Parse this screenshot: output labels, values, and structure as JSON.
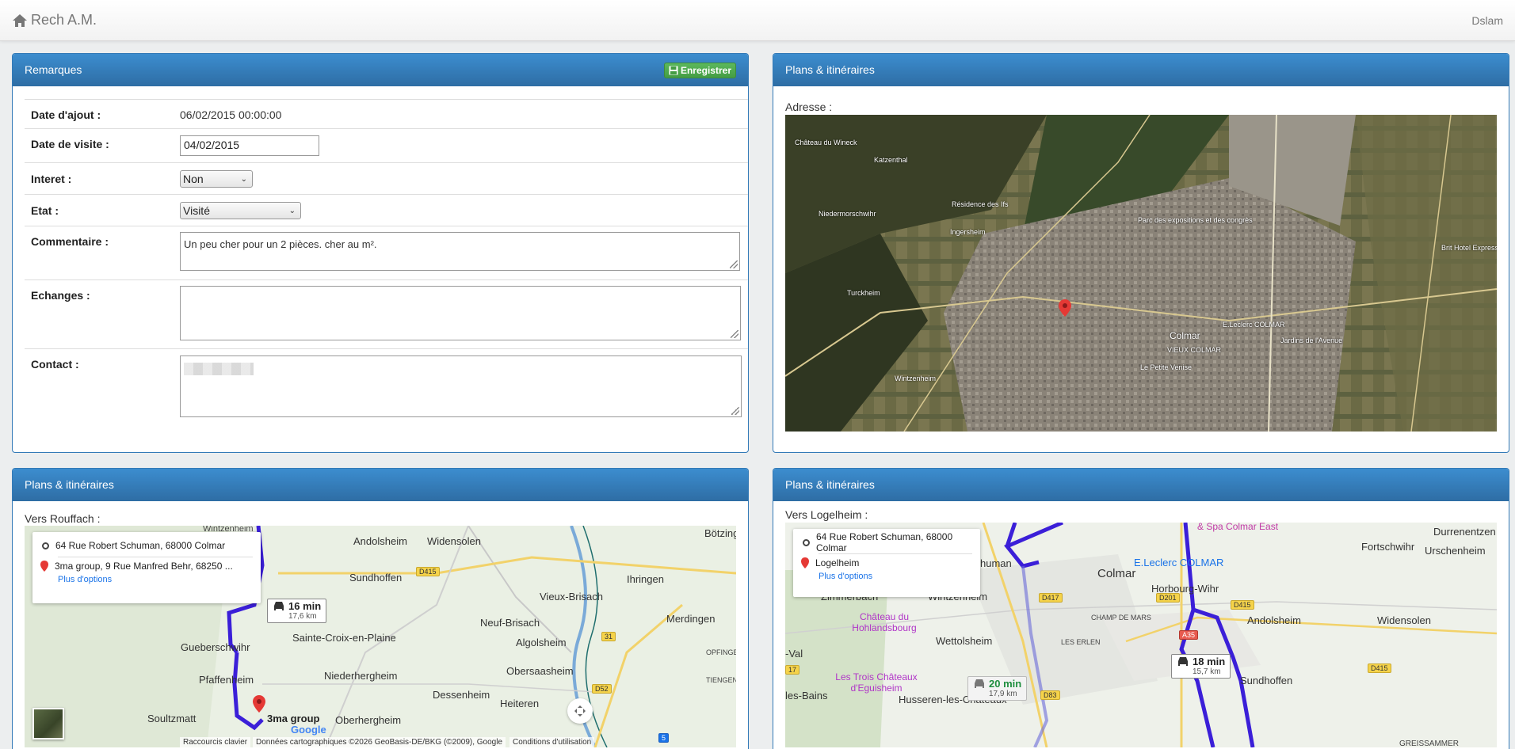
{
  "navbar": {
    "brand": "Rech A.M.",
    "user": "Dslam"
  },
  "remarques": {
    "title": "Remarques",
    "save_label": "Enregistrer",
    "fields": {
      "date_ajout": {
        "label": "Date d'ajout :",
        "value": "06/02/2015 00:00:00"
      },
      "date_visite": {
        "label": "Date de visite :",
        "value": "04/02/2015"
      },
      "interet": {
        "label": "Interet :",
        "value": "Non"
      },
      "etat": {
        "label": "Etat :",
        "value": "Visité"
      },
      "commentaire": {
        "label": "Commentaire :",
        "value": "Un peu cher pour un 2 pièces. cher au m²."
      },
      "echanges": {
        "label": "Echanges :",
        "value": ""
      },
      "contact": {
        "label": "Contact :",
        "value": ""
      }
    }
  },
  "map_address": {
    "title": "Plans & itinéraires",
    "caption": "Adresse :",
    "labels": [
      "Château du Wineck",
      "Katzenthal",
      "Niedermorschwihr",
      "Ingersheim",
      "Résidence des Ifs",
      "Parc des expositions et des congrès",
      "Turckheim",
      "Colmar",
      "VIEUX COLMAR",
      "Le Petite Venise",
      "Wintzenheim",
      "E.Leclerc COLMAR",
      "Jardins de l'Avenue",
      "Brit Hotel Express Colmar"
    ]
  },
  "map_rouffach": {
    "title": "Plans & itinéraires",
    "caption": "Vers Rouffach :",
    "origin": "64 Rue Robert Schuman, 68000 Colmar",
    "destination": "3ma group, 9 Rue Manfred Behr, 68250 ...",
    "more_options": "Plus d'options",
    "time": "16 min",
    "distance": "17,6 km",
    "dest_label": "3ma group",
    "labels": [
      "Wintzenheim",
      "Andolsheim",
      "Widensolen",
      "Bötzingen",
      "Sundhoffen",
      "Ihringen",
      "Vieux-Brisach",
      "Neuf-Brisach",
      "Merdingen",
      "Gueberschwihr",
      "Sainte-Croix-en-Plaine",
      "Algolsheim",
      "Pfaffenheim",
      "Niederhergheim",
      "Obersaasheim",
      "Dessenheim",
      "Heiteren",
      "Soultzmatt",
      "Oberhergheim",
      "OPFINGEN",
      "TIENGEN"
    ],
    "roads": [
      "D415",
      "31",
      "D52",
      "5"
    ],
    "attribution": [
      "Raccourcis clavier",
      "Données cartographiques ©2026 GeoBasis-DE/BKG (©2009), Google",
      "Conditions d'utilisation"
    ],
    "google": "Google"
  },
  "map_logelheim": {
    "title": "Plans & itinéraires",
    "caption": "Vers Logelheim :",
    "origin": "64 Rue Robert Schuman, 68000 Colmar",
    "destination": "Logelheim",
    "more_options": "Plus d'options",
    "time": "18 min",
    "distance": "15,7 km",
    "alt_time": "20 min",
    "alt_distance": "17,9 km",
    "labels": [
      "& Spa Colmar East",
      "Durrenentzen",
      "Fortschwihr",
      "Urschenheim",
      "E.Leclerc COLMAR",
      "Colmar",
      "Horbourg-Wihr",
      "Zimmerbach",
      "Wintzenheim",
      "Château du Hohlandsbourg",
      "CHAMP DE MARS",
      "Andolsheim",
      "Widensolen",
      "Wettolsheim",
      "LES ERLEN",
      "Les Trois Châteaux d'Eguisheim",
      "Husseren-les-Châteaux",
      "-Val",
      "les-Bains",
      "Sundhoffen",
      "human",
      "GREISSAMMER"
    ],
    "roads": [
      "D417",
      "D201",
      "D415",
      "A35",
      "D83",
      "D415",
      "17"
    ]
  }
}
